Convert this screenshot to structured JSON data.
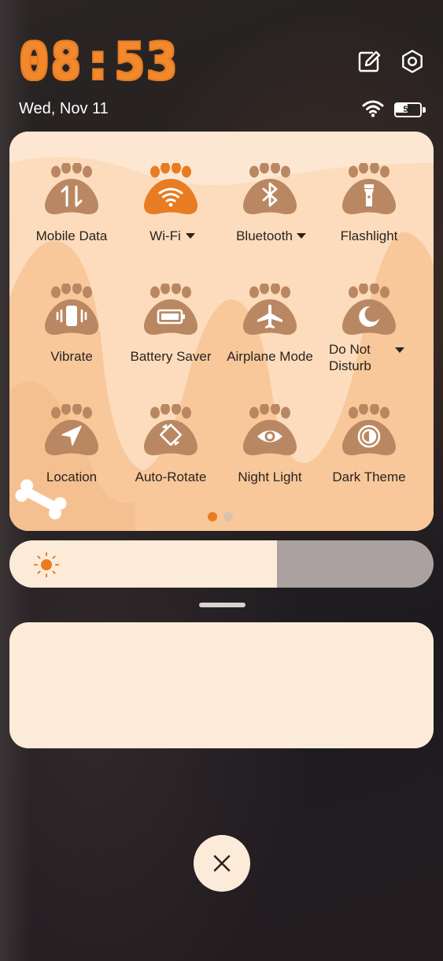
{
  "status": {
    "time": "08:53",
    "date": "Wed, Nov 11",
    "battery_level": "50"
  },
  "header_icons": [
    "edit-icon",
    "settings-icon"
  ],
  "colors": {
    "accent": "#e87c22",
    "tile_inactive": "#b98862",
    "panel_bg": "#fde7d3",
    "brightness_track": "#aaa1a0"
  },
  "tiles": [
    {
      "label": "Mobile Data",
      "icon": "mobile-data-icon",
      "active": false
    },
    {
      "label": "Wi-Fi",
      "icon": "wifi-icon",
      "active": true,
      "dropdown": true
    },
    {
      "label": "Bluetooth",
      "icon": "bluetooth-icon",
      "active": false,
      "dropdown": true
    },
    {
      "label": "Flashlight",
      "icon": "flashlight-icon",
      "active": false
    },
    {
      "label": "Vibrate",
      "icon": "vibrate-icon",
      "active": false
    },
    {
      "label": "Battery Saver",
      "icon": "battery-saver-icon",
      "active": false
    },
    {
      "label": "Airplane Mode",
      "icon": "airplane-icon",
      "active": false
    },
    {
      "label": "Do Not Disturb",
      "icon": "moon-icon",
      "active": false,
      "dropdown": true
    },
    {
      "label": "Location",
      "icon": "location-icon",
      "active": false
    },
    {
      "label": "Auto-Rotate",
      "icon": "rotate-icon",
      "active": false
    },
    {
      "label": "Night Light",
      "icon": "eye-icon",
      "active": false
    },
    {
      "label": "Dark Theme",
      "icon": "dark-theme-icon",
      "active": false
    }
  ],
  "pager": {
    "pages": 2,
    "current": 1
  },
  "brightness": {
    "level_fraction": 0.63,
    "icon": "sun-icon"
  },
  "close": {
    "icon": "close-icon"
  }
}
